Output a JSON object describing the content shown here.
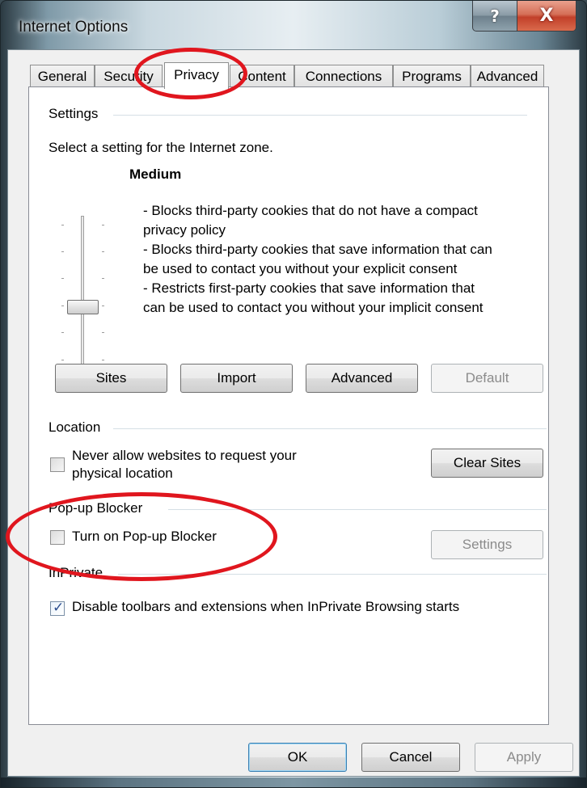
{
  "window": {
    "title": "Internet Options",
    "help_glyph": "?",
    "close_glyph": "X"
  },
  "tabs": [
    {
      "label": "General"
    },
    {
      "label": "Security"
    },
    {
      "label": "Privacy",
      "active": true
    },
    {
      "label": "Content"
    },
    {
      "label": "Connections"
    },
    {
      "label": "Programs"
    },
    {
      "label": "Advanced"
    }
  ],
  "settings": {
    "group_label": "Settings",
    "zone_prompt": "Select a setting for the Internet zone.",
    "level_name": "Medium",
    "level_fraction": 0.5,
    "description_lines": [
      "- Blocks third-party cookies that do not have a compact",
      "privacy policy",
      "- Blocks third-party cookies that save information that can",
      "be used to contact you without your explicit consent",
      "- Restricts first-party cookies that save information that",
      "can be used to contact you without your implicit consent"
    ],
    "buttons": {
      "sites": "Sites",
      "import": "Import",
      "advanced": "Advanced",
      "default": "Default"
    }
  },
  "location": {
    "group_label": "Location",
    "checkbox_label_line1": "Never allow websites to request your",
    "checkbox_label_line2": "physical location",
    "checked": false,
    "clear_sites": "Clear Sites"
  },
  "popup": {
    "group_label": "Pop-up Blocker",
    "checkbox_label": "Turn on Pop-up Blocker",
    "checked": false,
    "settings_button": "Settings"
  },
  "inprivate": {
    "group_label": "InPrivate",
    "checkbox_label": "Disable toolbars and extensions when InPrivate Browsing starts",
    "checked": true
  },
  "footer": {
    "ok": "OK",
    "cancel": "Cancel",
    "apply": "Apply"
  },
  "colors": {
    "annotation": "#e0161e",
    "checkmark": "#2b4d8f"
  }
}
